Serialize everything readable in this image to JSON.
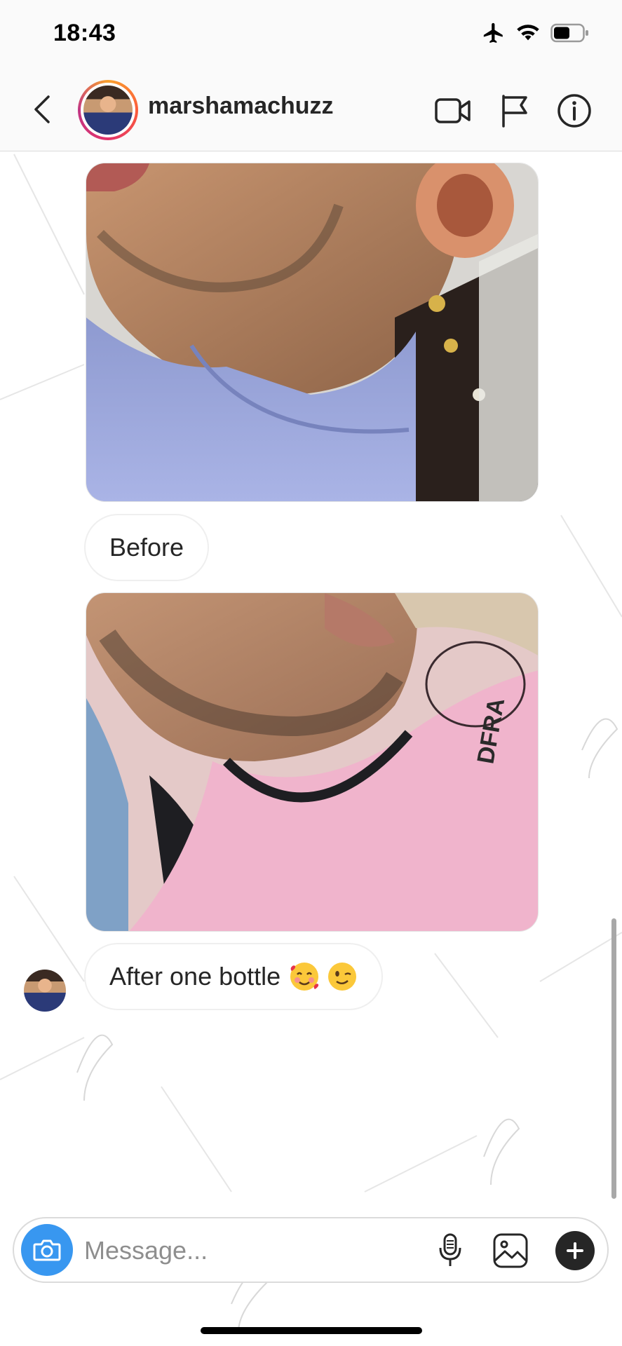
{
  "status_bar": {
    "time": "18:43",
    "icons": [
      "airplane-icon",
      "wifi-icon",
      "battery-icon"
    ]
  },
  "header": {
    "username": "marshamachuzz",
    "icons": [
      "back-icon",
      "video-call-icon",
      "flag-icon",
      "info-icon"
    ]
  },
  "messages": [
    {
      "type": "photo",
      "description": "before-photo"
    },
    {
      "type": "text",
      "text": "Before"
    },
    {
      "type": "photo",
      "description": "after-photo"
    },
    {
      "type": "text",
      "text": "After one bottle",
      "emojis": [
        "smiling-face-with-hearts-emoji",
        "winking-face-emoji"
      ]
    }
  ],
  "composer": {
    "placeholder": "Message...",
    "icons": [
      "camera-icon",
      "microphone-icon",
      "gallery-icon",
      "plus-icon"
    ]
  },
  "colors": {
    "accent": "#3897f0",
    "text": "#262626",
    "muted": "#8e8e8e",
    "border": "#dbdbdb"
  }
}
